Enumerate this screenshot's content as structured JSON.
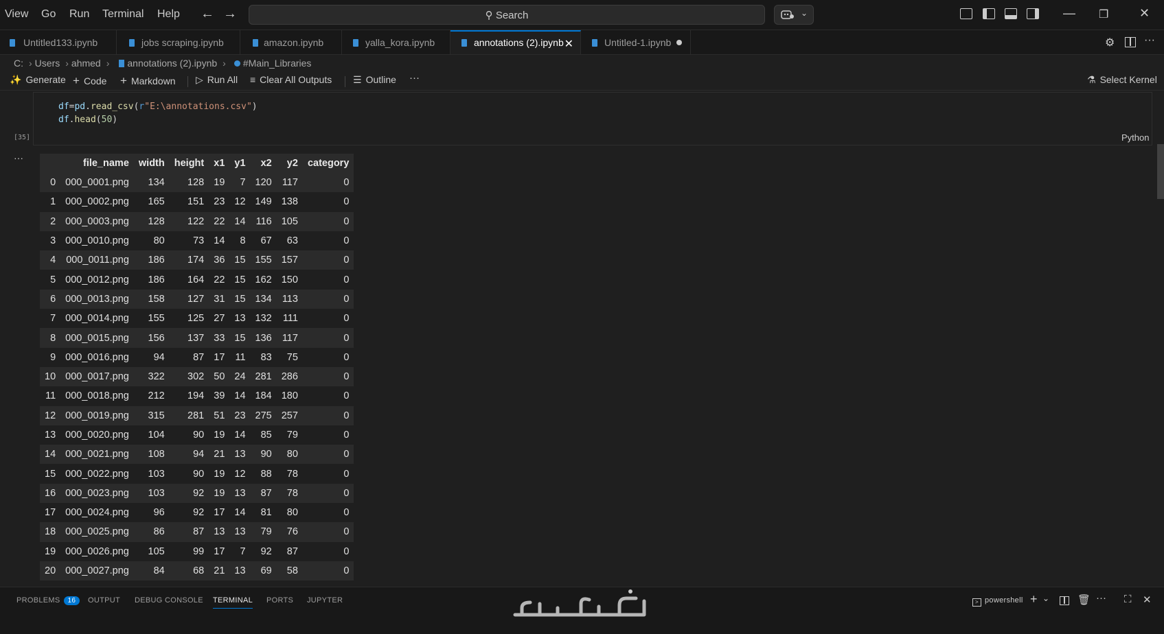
{
  "menu": [
    "View",
    "Go",
    "Run",
    "Terminal",
    "Help"
  ],
  "search": {
    "label": "Search"
  },
  "tabs": [
    {
      "label": "Untitled133.ipynb",
      "active": false
    },
    {
      "label": "jobs scraping.ipynb",
      "active": false
    },
    {
      "label": "amazon.ipynb",
      "active": false
    },
    {
      "label": "yalla_kora.ipynb",
      "active": false
    },
    {
      "label": "annotations (2).ipynb",
      "active": true
    },
    {
      "label": "Untitled-1.ipynb",
      "active": false,
      "modified": true
    }
  ],
  "breadcrumb": [
    "C:",
    "Users",
    "ahmed",
    "annotations (2).ipynb",
    "#Main_Libraries"
  ],
  "toolbar": {
    "generate": "Generate",
    "code": "Code",
    "markdown": "Markdown",
    "run_all": "Run All",
    "clear_outputs": "Clear All Outputs",
    "outline": "Outline",
    "more": "···",
    "select_kernel": "Select Kernel"
  },
  "cell": {
    "exec_count": "[35]",
    "language": "Python",
    "line1": {
      "var": "df",
      "op": "=",
      "mod": "pd",
      "fn": "read_csv",
      "pre": "r",
      "str": "\"E:\\annotations.csv\""
    },
    "line2": {
      "var": "df",
      "fn": "head",
      "num": "50"
    }
  },
  "output": {
    "dots": "···"
  },
  "dataframe": {
    "columns": [
      "",
      "file_name",
      "width",
      "height",
      "x1",
      "y1",
      "x2",
      "y2",
      "category"
    ],
    "rows": [
      [
        "0",
        "000_0001.png",
        "134",
        "128",
        "19",
        "7",
        "120",
        "117",
        "0"
      ],
      [
        "1",
        "000_0002.png",
        "165",
        "151",
        "23",
        "12",
        "149",
        "138",
        "0"
      ],
      [
        "2",
        "000_0003.png",
        "128",
        "122",
        "22",
        "14",
        "116",
        "105",
        "0"
      ],
      [
        "3",
        "000_0010.png",
        "80",
        "73",
        "14",
        "8",
        "67",
        "63",
        "0"
      ],
      [
        "4",
        "000_0011.png",
        "186",
        "174",
        "36",
        "15",
        "155",
        "157",
        "0"
      ],
      [
        "5",
        "000_0012.png",
        "186",
        "164",
        "22",
        "15",
        "162",
        "150",
        "0"
      ],
      [
        "6",
        "000_0013.png",
        "158",
        "127",
        "31",
        "15",
        "134",
        "113",
        "0"
      ],
      [
        "7",
        "000_0014.png",
        "155",
        "125",
        "27",
        "13",
        "132",
        "111",
        "0"
      ],
      [
        "8",
        "000_0015.png",
        "156",
        "137",
        "33",
        "15",
        "136",
        "117",
        "0"
      ],
      [
        "9",
        "000_0016.png",
        "94",
        "87",
        "17",
        "11",
        "83",
        "75",
        "0"
      ],
      [
        "10",
        "000_0017.png",
        "322",
        "302",
        "50",
        "24",
        "281",
        "286",
        "0"
      ],
      [
        "11",
        "000_0018.png",
        "212",
        "194",
        "39",
        "14",
        "184",
        "180",
        "0"
      ],
      [
        "12",
        "000_0019.png",
        "315",
        "281",
        "51",
        "23",
        "275",
        "257",
        "0"
      ],
      [
        "13",
        "000_0020.png",
        "104",
        "90",
        "19",
        "14",
        "85",
        "79",
        "0"
      ],
      [
        "14",
        "000_0021.png",
        "108",
        "94",
        "21",
        "13",
        "90",
        "80",
        "0"
      ],
      [
        "15",
        "000_0022.png",
        "103",
        "90",
        "19",
        "12",
        "88",
        "78",
        "0"
      ],
      [
        "16",
        "000_0023.png",
        "103",
        "92",
        "19",
        "13",
        "87",
        "78",
        "0"
      ],
      [
        "17",
        "000_0024.png",
        "96",
        "92",
        "17",
        "14",
        "81",
        "80",
        "0"
      ],
      [
        "18",
        "000_0025.png",
        "86",
        "87",
        "13",
        "13",
        "79",
        "76",
        "0"
      ],
      [
        "19",
        "000_0026.png",
        "105",
        "99",
        "17",
        "7",
        "92",
        "87",
        "0"
      ],
      [
        "20",
        "000_0027.png",
        "84",
        "68",
        "21",
        "13",
        "69",
        "58",
        "0"
      ]
    ]
  },
  "panel": {
    "problems": "PROBLEMS",
    "problems_count": "16",
    "output": "OUTPUT",
    "debug_console": "DEBUG CONSOLE",
    "terminal": "TERMINAL",
    "ports": "PORTS",
    "jupyter": "JUPYTER",
    "shell": "powershell"
  },
  "watermark": "خمسات",
  "colors": {
    "accent": "#0078d4",
    "notebook_icon": "#3a8fd6",
    "background": "#1f1f1f"
  }
}
